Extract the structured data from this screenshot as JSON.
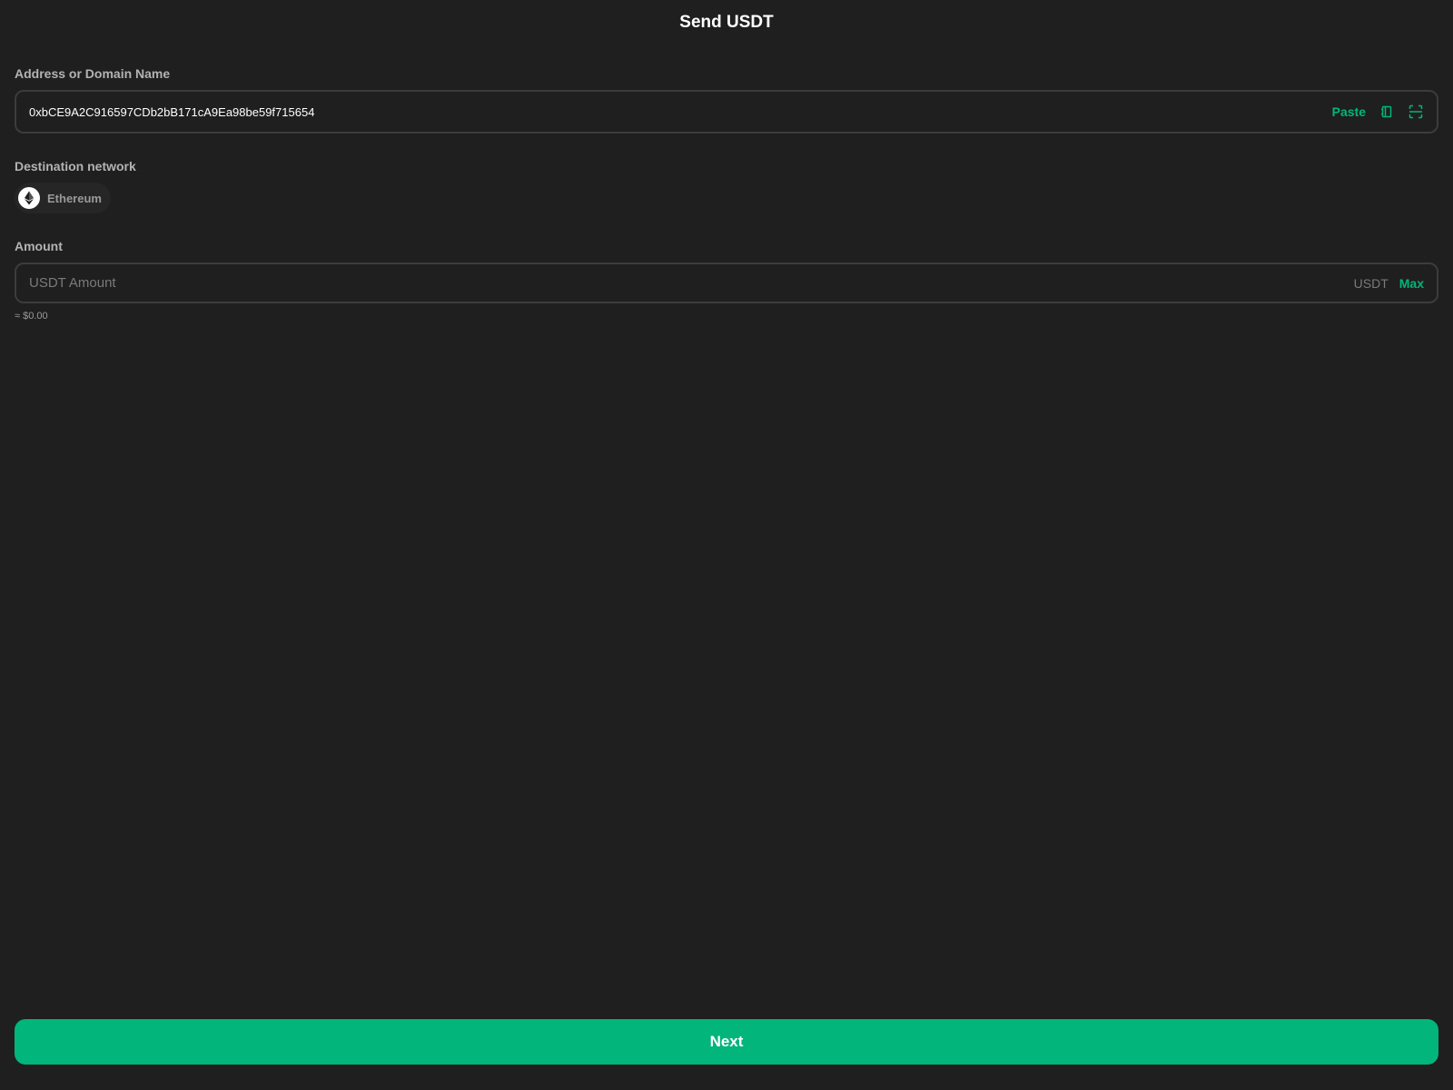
{
  "header": {
    "title": "Send USDT"
  },
  "address": {
    "label": "Address or Domain Name",
    "value": "0xbCE9A2C916597CDb2bB171cA9Ea98be59f715654",
    "paste_label": "Paste",
    "address_book_icon": "address-book-icon",
    "scan_icon": "scan-icon"
  },
  "network": {
    "label": "Destination network",
    "selected": "Ethereum",
    "icon": "ethereum-icon"
  },
  "amount": {
    "label": "Amount",
    "placeholder": "USDT Amount",
    "value": "",
    "unit": "USDT",
    "max_label": "Max",
    "fiat_estimate": "≈ $0.00"
  },
  "footer": {
    "next_label": "Next"
  },
  "colors": {
    "background": "#1f1f1f",
    "accent": "#02b57a",
    "border": "#3c3c3c",
    "label": "#b3b3b3"
  }
}
